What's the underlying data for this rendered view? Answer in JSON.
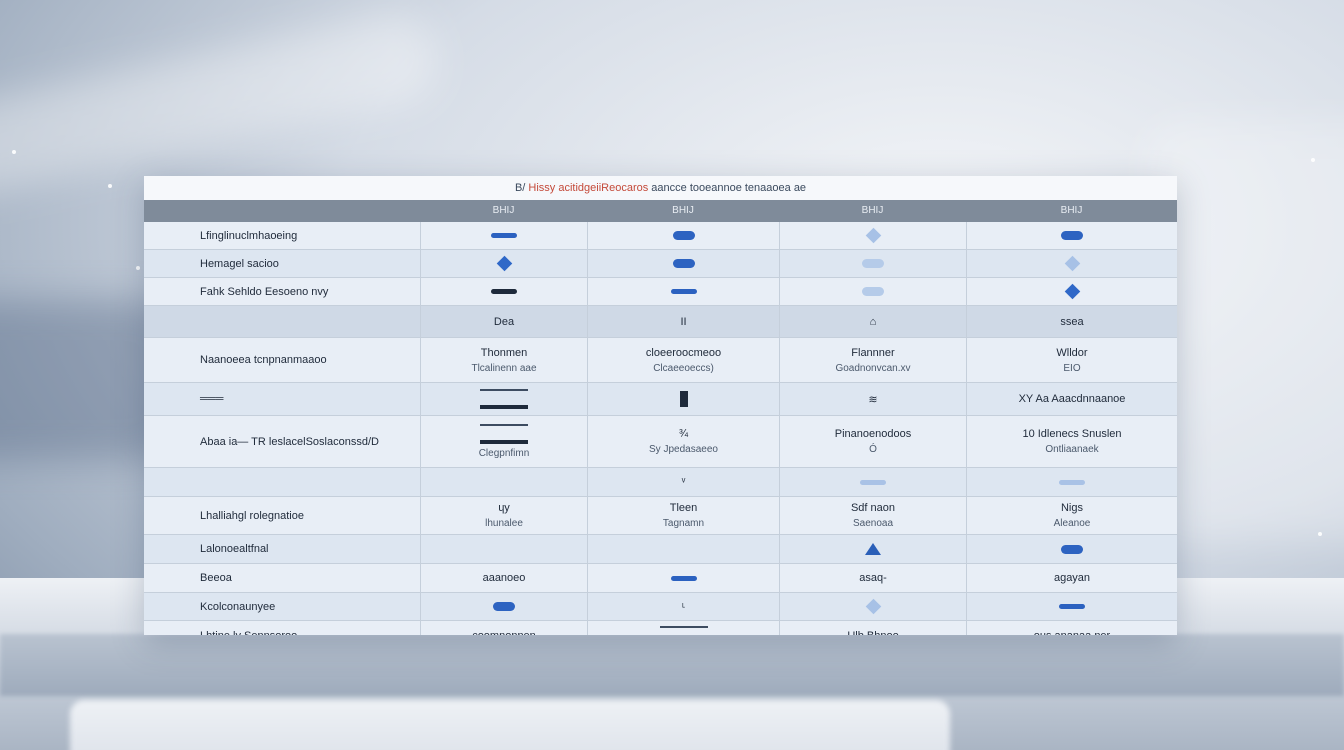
{
  "title": {
    "prefix": "B/",
    "text": "Hissy acitidgeiiReocaros",
    "suffix": "aancce tooeannoe tenaaoea ae"
  },
  "columns": [
    "",
    "BHIJ",
    "BHIJ",
    "BHIJ",
    "BHIJ"
  ],
  "rows": [
    {
      "label": "Lfinglinuclmhaoeing",
      "c1": {
        "mark": "m-dash"
      },
      "c2": {
        "mark": "m-blob"
      },
      "c3": {
        "mark": "m-dia faint"
      },
      "c4": {
        "mark": "m-blob"
      }
    },
    {
      "label": "Hemagel sacioo",
      "c1": {
        "mark": "m-dia"
      },
      "c2": {
        "mark": "m-blob"
      },
      "c3": {
        "mark": "m-blob faint"
      },
      "c4": {
        "mark": "m-dia faint"
      }
    },
    {
      "label": "Fahk Sehldo Eesoeno nvy",
      "c1": {
        "mark": "m-dash dark"
      },
      "c2": {
        "mark": "m-dash"
      },
      "c3": {
        "mark": "m-blob faint"
      },
      "c4": {
        "mark": "m-dia"
      }
    },
    {
      "label": "",
      "c1": {
        "text": "Dea"
      },
      "c2": {
        "text": "II"
      },
      "c3": {
        "text": "⌂"
      },
      "c4": {
        "text": "ssea"
      }
    },
    {
      "label": "Naanoeea tcnpnanmaaoo",
      "c1": {
        "text": "Thonmen",
        "sub": "Tlcalinenn aae"
      },
      "c2": {
        "text": "cloeeroocmeoo",
        "sub": "Clcaeeoeccs)"
      },
      "c3": {
        "text": "Flannner",
        "sub": "Goadnonvcan.xv"
      },
      "c4": {
        "text": "Wlldor",
        "sub": "EIO"
      }
    },
    {
      "label": "═══",
      "c1": {
        "mark": "m-ship"
      },
      "c2": {
        "mark": "m-tall"
      },
      "c3": {
        "text": "≋"
      },
      "c4": {
        "text": "XY Aa Aaacdnnaanoe"
      }
    },
    {
      "label": "Abaa ia— TR leslacelSoslaconssd/D",
      "c1": {
        "mark": "m-ship",
        "sub": "Clegpnfimn"
      },
      "c2": {
        "text": "¾",
        "sub": "Sy Jpedasaeeo"
      },
      "c3": {
        "text": "Pinanoenodoos",
        "sub": "Ó"
      },
      "c4": {
        "text": "10 Idlenecs Snuslen",
        "sub": "Ontliaanaek"
      }
    },
    {
      "label": "",
      "c1": {
        "text": ""
      },
      "c2": {
        "text": "ᵛ"
      },
      "c3": {
        "mark": "m-dash faint"
      },
      "c4": {
        "mark": "m-dash faint"
      }
    },
    {
      "label": "Lhalliahgl rolegnatioe",
      "c1": {
        "text": "ɥy",
        "sub": "lhunalee"
      },
      "c2": {
        "text": "Tleen",
        "sub": "Tagnamn"
      },
      "c3": {
        "text": "Sdf naon",
        "sub": "Saenoaa"
      },
      "c4": {
        "text": "Nigs",
        "sub": "Aleanoe"
      }
    },
    {
      "label": "Lalonoealtfnal",
      "c1": {
        "text": ""
      },
      "c2": {
        "text": ""
      },
      "c3": {
        "mark": "m-tri"
      },
      "c4": {
        "mark": "m-blob"
      }
    },
    {
      "label": "Beeoa",
      "c1": {
        "text": "aaanoeo"
      },
      "c2": {
        "mark": "m-dash"
      },
      "c3": {
        "text": "asaq-"
      },
      "c4": {
        "text": "agayan"
      }
    },
    {
      "label": "Kcolconaunyee",
      "c1": {
        "mark": "m-blob"
      },
      "c2": {
        "text": "ᶫ"
      },
      "c3": {
        "mark": "m-dia faint"
      },
      "c4": {
        "mark": "m-dash"
      }
    },
    {
      "label": "Lhtine ly Sennsoroo",
      "c1": {
        "text": "coomnonnen"
      },
      "c2": {
        "mark": "m-ship"
      },
      "c3": {
        "text": "Ulb Bhnoo"
      },
      "c4": {
        "text": "ous ananaa ner"
      }
    }
  ]
}
